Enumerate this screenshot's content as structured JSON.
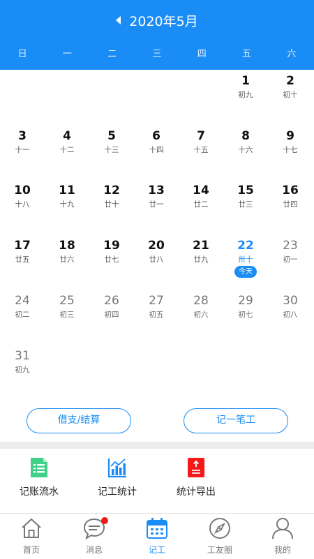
{
  "header": {
    "title": "2020年5月"
  },
  "weekdays": [
    "日",
    "一",
    "二",
    "三",
    "四",
    "五",
    "六"
  ],
  "days": [
    {
      "d": "1",
      "l": "初九"
    },
    {
      "d": "2",
      "l": "初十"
    },
    {
      "d": "3",
      "l": "十一"
    },
    {
      "d": "4",
      "l": "十二"
    },
    {
      "d": "5",
      "l": "十三"
    },
    {
      "d": "6",
      "l": "十四"
    },
    {
      "d": "7",
      "l": "十五"
    },
    {
      "d": "8",
      "l": "十六"
    },
    {
      "d": "9",
      "l": "十七"
    },
    {
      "d": "10",
      "l": "十八"
    },
    {
      "d": "11",
      "l": "十九"
    },
    {
      "d": "12",
      "l": "廿十"
    },
    {
      "d": "13",
      "l": "廿一"
    },
    {
      "d": "14",
      "l": "廿二"
    },
    {
      "d": "15",
      "l": "廿三"
    },
    {
      "d": "16",
      "l": "廿四"
    },
    {
      "d": "17",
      "l": "廿五"
    },
    {
      "d": "18",
      "l": "廿六"
    },
    {
      "d": "19",
      "l": "廿七"
    },
    {
      "d": "20",
      "l": "廿八"
    },
    {
      "d": "21",
      "l": "廿九"
    },
    {
      "d": "22",
      "l": "卅十"
    },
    {
      "d": "23",
      "l": "初一"
    },
    {
      "d": "24",
      "l": "初二"
    },
    {
      "d": "25",
      "l": "初三"
    },
    {
      "d": "26",
      "l": "初四"
    },
    {
      "d": "27",
      "l": "初五"
    },
    {
      "d": "28",
      "l": "初六"
    },
    {
      "d": "29",
      "l": "初七"
    },
    {
      "d": "30",
      "l": "初八"
    },
    {
      "d": "31",
      "l": "初九"
    }
  ],
  "first_weekday": 5,
  "today": "22",
  "today_badge": "今天",
  "actions": {
    "borrow": "借支/结算",
    "record": "记一笔工"
  },
  "tools": [
    {
      "label": "记账流水",
      "icon": "ledger-icon",
      "color": "#3fd18a"
    },
    {
      "label": "记工统计",
      "icon": "bar-chart-icon",
      "color": "#1a8cf5"
    },
    {
      "label": "统计导出",
      "icon": "export-icon",
      "color": "#f51818"
    }
  ],
  "tabs": [
    {
      "label": "首页",
      "icon": "home-icon"
    },
    {
      "label": "消息",
      "icon": "message-icon",
      "badge": true
    },
    {
      "label": "记工",
      "icon": "calendar-icon",
      "active": true
    },
    {
      "label": "工友圈",
      "icon": "compass-icon"
    },
    {
      "label": "我的",
      "icon": "user-icon"
    }
  ],
  "colors": {
    "primary": "#1a8cf5",
    "badge": "#f51818"
  }
}
